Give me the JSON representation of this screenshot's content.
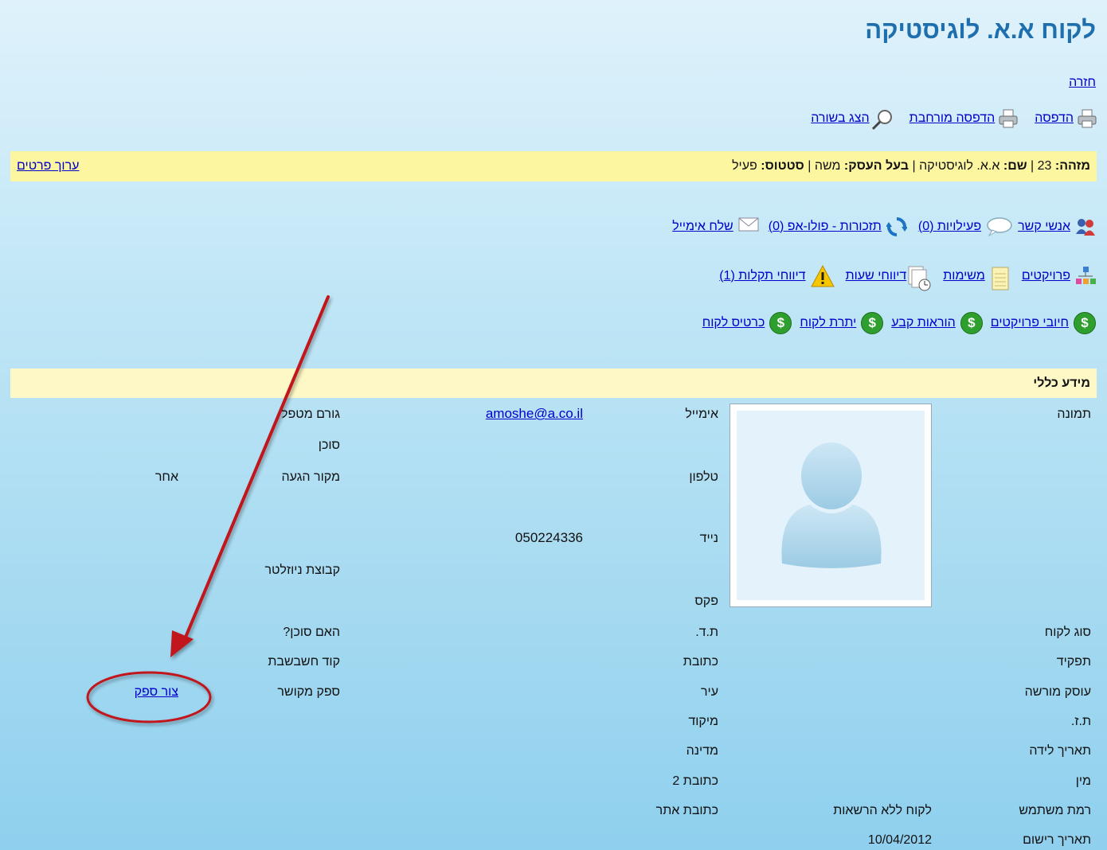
{
  "page": {
    "title": "לקוח א.א. לוגיסטיקה",
    "back_link": "חזרה"
  },
  "toolbar": {
    "print": "הדפסה",
    "extended_print": "הדפסה מורחבת",
    "show_in_row": "הצג בשורה"
  },
  "infobar": {
    "id_label": "מזהה:",
    "id_value": "23",
    "name_label": "שם:",
    "name_value": "א.א. לוגיסטיקה",
    "owner_label": "בעל העסק:",
    "owner_value": "משה",
    "status_label": "סטטוס:",
    "status_value": "פעיל",
    "sep": "|",
    "edit_link": "ערוך פרטים"
  },
  "links_row1": {
    "contacts": "אנשי קשר",
    "activities": "פעילויות (0)",
    "reminders": "תזכורות - פולו-אפ (0)",
    "send_email": "שלח אימייל"
  },
  "links_row2": {
    "projects": "פרויקטים",
    "tasks": "משימות",
    "hour_reports": "דיווחי שעות",
    "fault_reports": "דיווחי תקלות (1)"
  },
  "links_row3": {
    "project_charges": "חיובי פרויקטים",
    "standing_orders": "הוראות קבע",
    "customer_balance": "יתרת לקוח",
    "customer_cards": "כרטיס לקוח"
  },
  "section": {
    "title": "מידע כללי"
  },
  "col1": {
    "photo": "תמונה",
    "customer_type": "סוג לקוח",
    "role": "תפקיד",
    "licensed_dealer": "עוסק מורשה",
    "id_number": "ת.ז.",
    "birth_date": "תאריך לידה",
    "gender": "מין",
    "user_level": "רמת משתמש",
    "user_level_value": "לקוח ללא הרשאות",
    "registration_date": "תאריך רישום",
    "registration_date_value": "10/04/2012"
  },
  "col2": {
    "email": "אימייל",
    "email_value": "amoshe@a.co.il",
    "phone": "טלפון",
    "mobile": "נייד",
    "mobile_value": "050224336",
    "fax": "פקס",
    "po_box": "ת.ד.",
    "address": "כתובת",
    "city": "עיר",
    "zip": "מיקוד",
    "country": "מדינה",
    "address2": "כתובת 2",
    "website": "כתובת אתר"
  },
  "col3": {
    "handler": "גורם מטפל",
    "agent": "סוכן",
    "source": "מקור הגעה",
    "source_value": "אחר",
    "newsletter_group": "קבוצת ניוזלטר",
    "is_agent": "האם סוכן?",
    "accounting_code": "קוד חשבשבת",
    "linked_supplier": "ספק מקושר",
    "create_supplier": "צור ספק"
  },
  "colors": {
    "title": "#1f6fae",
    "infobar_bg": "#fdf6a0",
    "section_bg": "#fef8c6",
    "link": "#0000cc",
    "annotation": "#c0141b"
  }
}
